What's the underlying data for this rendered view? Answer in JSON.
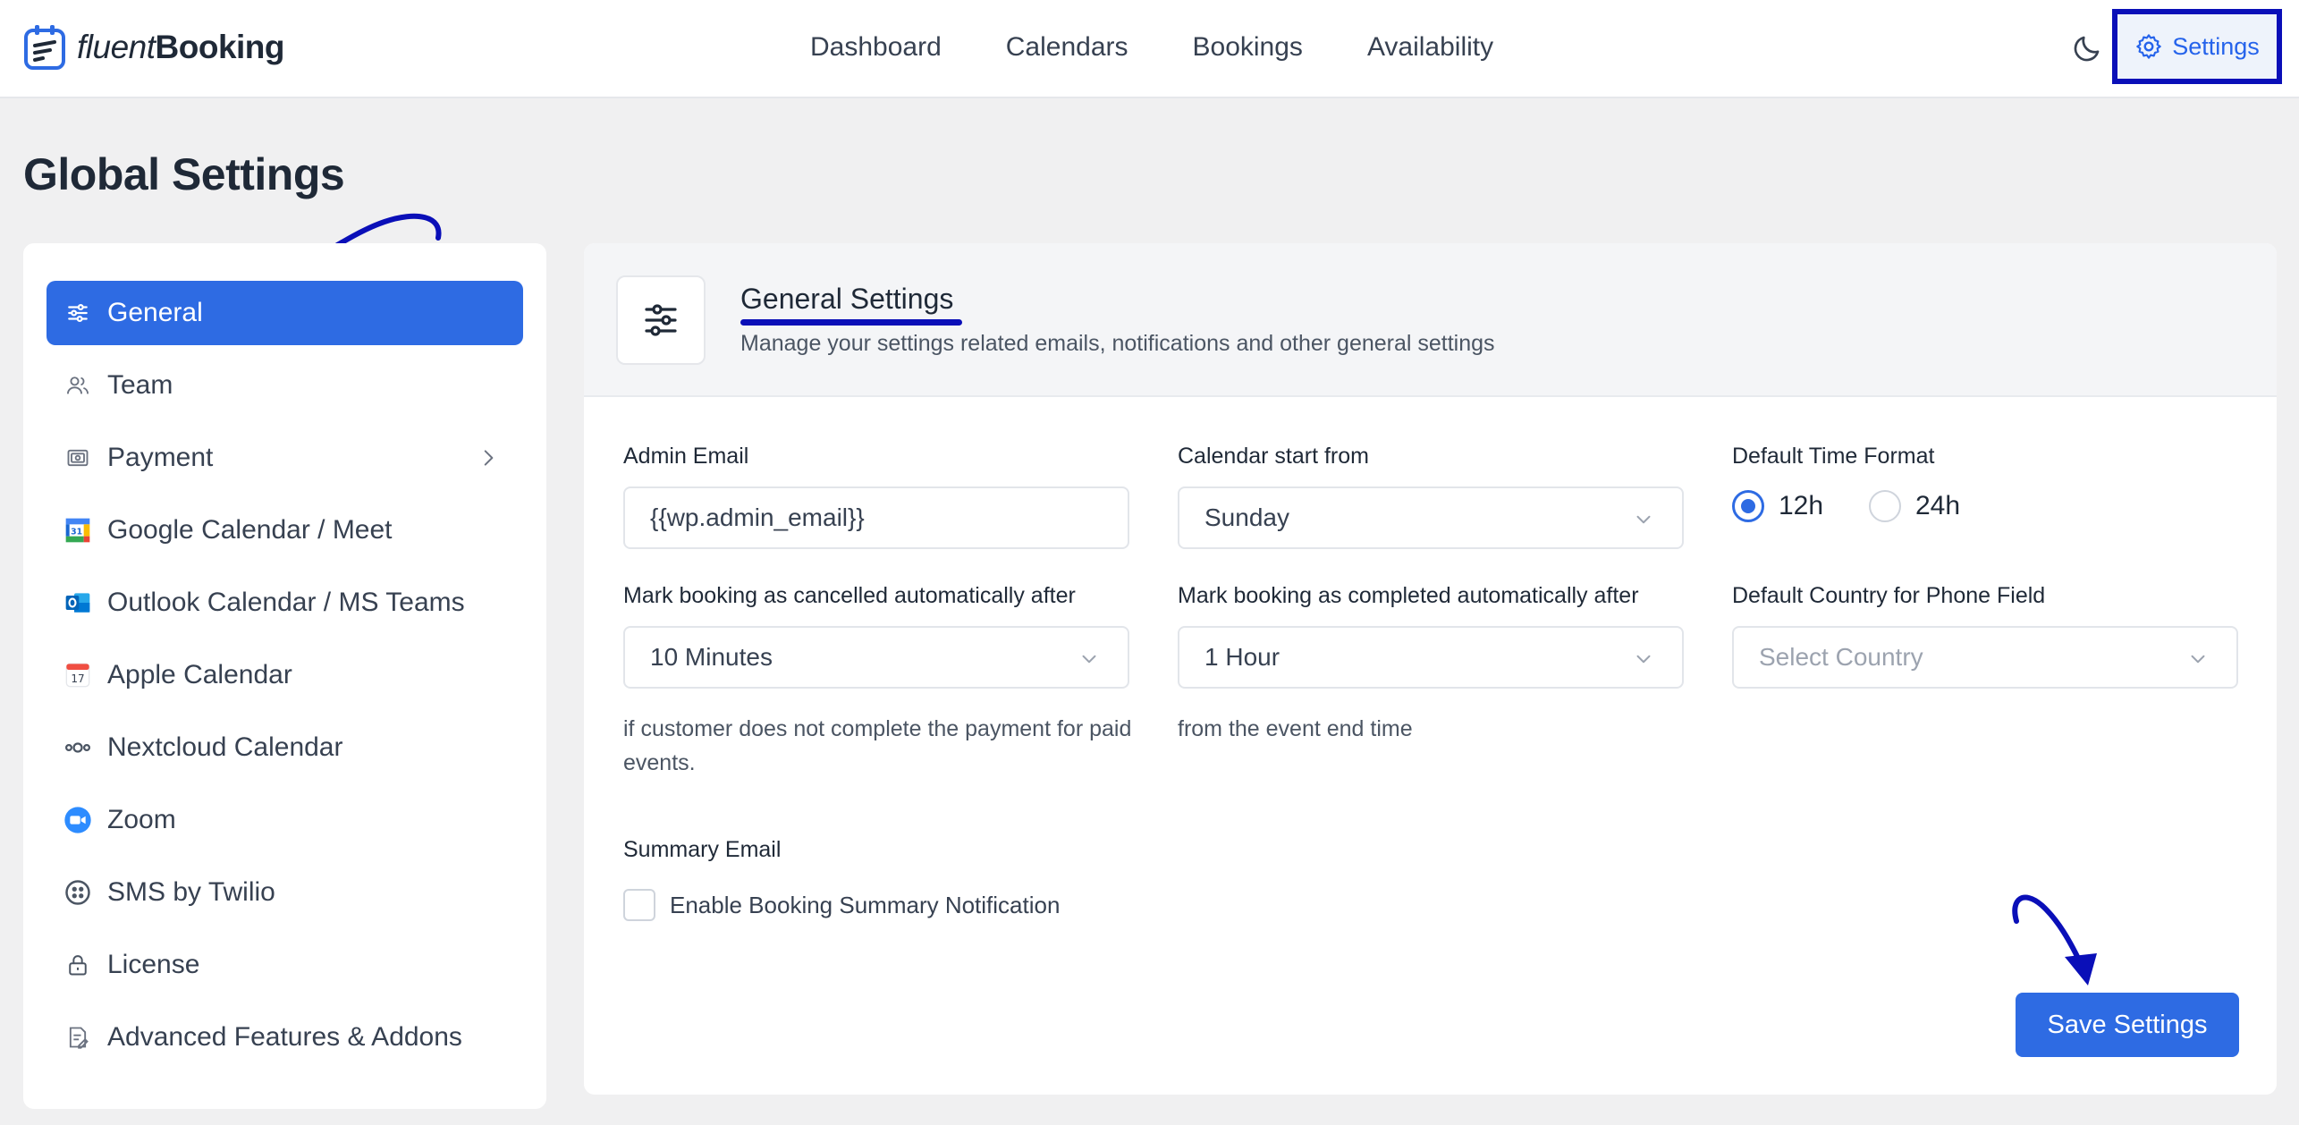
{
  "brand": {
    "name_light": "fluent",
    "name_bold": "Booking"
  },
  "nav": {
    "items": [
      {
        "label": "Dashboard"
      },
      {
        "label": "Calendars"
      },
      {
        "label": "Bookings"
      },
      {
        "label": "Availability"
      }
    ],
    "settings_label": "Settings"
  },
  "page": {
    "title": "Global Settings"
  },
  "sidebar": {
    "items": [
      {
        "label": "General",
        "icon": "sliders-icon",
        "active": true
      },
      {
        "label": "Team",
        "icon": "users-icon"
      },
      {
        "label": "Payment",
        "icon": "payment-icon"
      },
      {
        "label": "Google Calendar / Meet",
        "icon": "google-calendar-icon"
      },
      {
        "label": "Outlook Calendar / MS Teams",
        "icon": "outlook-icon"
      },
      {
        "label": "Apple Calendar",
        "icon": "apple-calendar-icon"
      },
      {
        "label": "Nextcloud Calendar",
        "icon": "nextcloud-icon"
      },
      {
        "label": "Zoom",
        "icon": "zoom-icon"
      },
      {
        "label": "SMS by Twilio",
        "icon": "twilio-icon"
      },
      {
        "label": "License",
        "icon": "lock-icon"
      },
      {
        "label": "Advanced Features & Addons",
        "icon": "addons-icon"
      }
    ]
  },
  "general": {
    "title": "General Settings",
    "description": "Manage your settings related emails, notifications and other general settings",
    "admin_email": {
      "label": "Admin Email",
      "value": "{{wp.admin_email}}"
    },
    "calendar_start": {
      "label": "Calendar start from",
      "value": "Sunday"
    },
    "time_format": {
      "label": "Default Time Format",
      "options": [
        "12h",
        "24h"
      ],
      "selected": "12h"
    },
    "auto_cancel": {
      "label": "Mark booking as cancelled automatically after",
      "value": "10 Minutes",
      "help": "if customer does not complete the payment for paid events."
    },
    "auto_complete": {
      "label": "Mark booking as completed automatically after",
      "value": "1 Hour",
      "help": "from the event end time"
    },
    "country": {
      "label": "Default Country for Phone Field",
      "placeholder": "Select Country"
    },
    "summary_email": {
      "label": "Summary Email",
      "checkbox_label": "Enable Booking Summary Notification",
      "checked": false
    },
    "save_label": "Save Settings"
  },
  "colors": {
    "accent": "#2e6be3",
    "annotation": "#0a0fb8",
    "background": "#f0f0f1"
  }
}
